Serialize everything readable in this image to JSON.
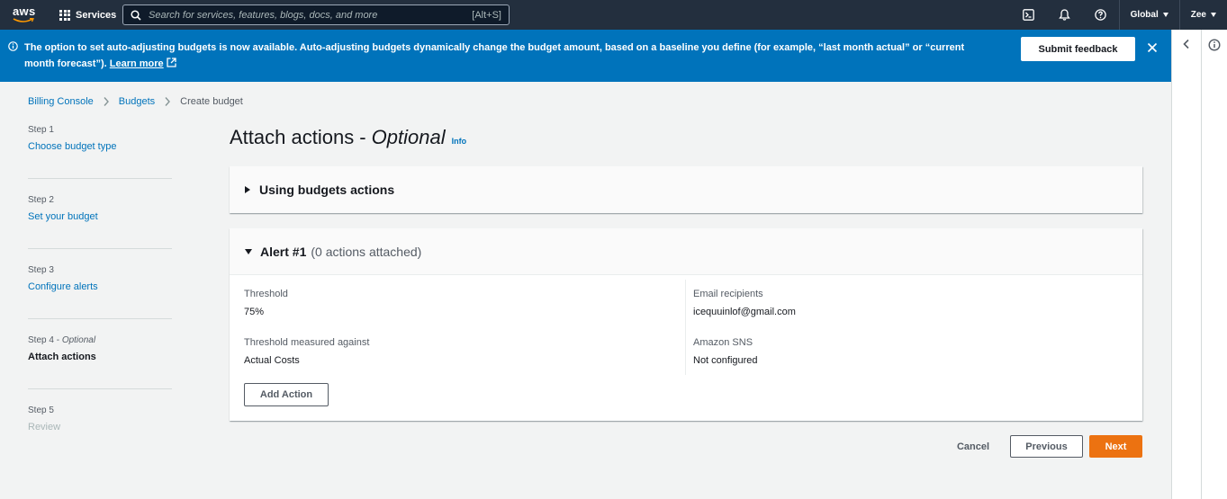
{
  "topnav": {
    "logo_text": "aws",
    "services_label": "Services",
    "search_placeholder": "Search for services, features, blogs, docs, and more",
    "search_shortcut": "[Alt+S]",
    "region_label": "Global",
    "user_label": "Zee",
    "icons": [
      "cloudshell-icon",
      "notifications-icon",
      "help-icon"
    ]
  },
  "flash": {
    "message": "The option to set auto-adjusting budgets is now available. Auto-adjusting budgets dynamically change the budget amount, based on a baseline you define (for example, “last month actual” or “current month forecast”).",
    "learn_more": "Learn more",
    "feedback_button": "Submit feedback",
    "color": "#0073bb"
  },
  "breadcrumb": {
    "items": [
      "Billing Console",
      "Budgets"
    ],
    "current": "Create budget"
  },
  "steps": [
    {
      "number": "Step 1",
      "label": "Choose budget type",
      "state": "link"
    },
    {
      "number": "Step 2",
      "label": "Set your budget",
      "state": "link"
    },
    {
      "number": "Step 3",
      "label": "Configure alerts",
      "state": "link"
    },
    {
      "number": "Step 4",
      "optional": "Optional",
      "label": "Attach actions",
      "state": "active"
    },
    {
      "number": "Step 5",
      "label": "Review",
      "state": "disabled"
    }
  ],
  "main": {
    "title": "Attach actions -",
    "title_optional": "Optional",
    "info_link": "Info",
    "panel1_title": "Using budgets actions",
    "alert": {
      "title": "Alert #1",
      "subtitle": "(0 actions attached)",
      "threshold_label": "Threshold",
      "threshold_value": "75%",
      "measured_label": "Threshold measured against",
      "measured_value": "Actual Costs",
      "email_label": "Email recipients",
      "email_value": "icequuinlof@gmail.com",
      "sns_label": "Amazon SNS",
      "sns_value": "Not configured",
      "add_action": "Add Action"
    }
  },
  "footer": {
    "cancel": "Cancel",
    "previous": "Previous",
    "next": "Next",
    "next_color": "#ec7211"
  }
}
